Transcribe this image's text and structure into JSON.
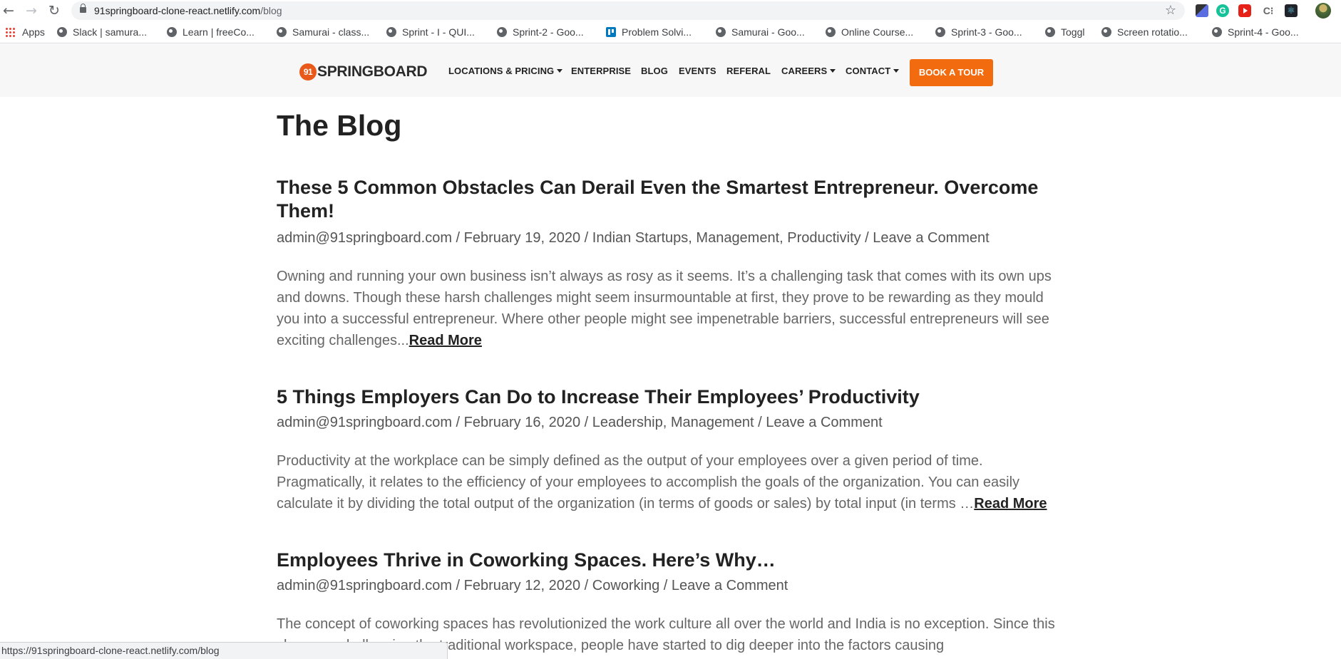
{
  "browser": {
    "url_host": "91springboard-clone-react.netlify.com",
    "url_path": "/blog",
    "bookmarks": [
      {
        "label": "Apps",
        "icon": "apps-grid-icon"
      },
      {
        "label": "Slack | samura...",
        "icon": "globe-icon"
      },
      {
        "label": "Learn | freeCo...",
        "icon": "globe-icon"
      },
      {
        "label": "Samurai - class...",
        "icon": "globe-icon"
      },
      {
        "label": "Sprint - I - QUI...",
        "icon": "globe-icon"
      },
      {
        "label": "Sprint-2 - Goo...",
        "icon": "globe-icon"
      },
      {
        "label": "Problem Solvi...",
        "icon": "trello-icon"
      },
      {
        "label": "Samurai - Goo...",
        "icon": "globe-icon"
      },
      {
        "label": "Online Course...",
        "icon": "globe-icon"
      },
      {
        "label": "Sprint-3 - Goo...",
        "icon": "globe-icon"
      },
      {
        "label": "Toggl",
        "icon": "globe-icon"
      },
      {
        "label": "Screen rotatio...",
        "icon": "globe-icon"
      },
      {
        "label": "Sprint-4 - Goo...",
        "icon": "globe-icon"
      }
    ],
    "status_url": "https://91springboard-clone-react.netlify.com/blog"
  },
  "site": {
    "logo_number": "91",
    "logo_text": "SPRINGBOARD",
    "brand_color": "#f26b0f",
    "nav": [
      {
        "label": "LOCATIONS & PRICING",
        "dropdown": true
      },
      {
        "label": "ENTERPRISE",
        "dropdown": false
      },
      {
        "label": "BLOG",
        "dropdown": false
      },
      {
        "label": "EVENTS",
        "dropdown": false
      },
      {
        "label": "REFERAL",
        "dropdown": false
      },
      {
        "label": "CAREERS",
        "dropdown": true
      },
      {
        "label": "CONTACT",
        "dropdown": true
      }
    ],
    "cta_label": "BOOK A TOUR"
  },
  "page": {
    "title": "The Blog",
    "posts": [
      {
        "title": "These 5 Common Obstacles Can Derail Even the Smartest Entrepreneur. Overcome Them!",
        "meta": "admin@91springboard.com / February 19, 2020 / Indian Startups, Management, Productivity / Leave a Comment",
        "excerpt": "Owning and running your own business isn’t always as rosy as it seems. It’s a challenging task that comes with its own ups and downs. Though these harsh challenges might seem insurmountable at first, they prove to be rewarding as they mould you into a successful entrepreneur. Where other people might see impenetrable barriers, successful entrepreneurs will see exciting challenges...",
        "read_more": "Read More"
      },
      {
        "title": "5 Things Employers Can Do to Increase Their Employees’ Productivity",
        "meta": "admin@91springboard.com / February 16, 2020 / Leadership, Management / Leave a Comment",
        "excerpt": "Productivity at the workplace can be simply defined as the output of your employees over a given period of time. Pragmatically, it relates to the efficiency of your employees to accomplish the goals of the organization. You can easily calculate it by dividing the total output of the organization (in terms of goods or sales) by total input (in terms …",
        "read_more": "Read More"
      },
      {
        "title": "Employees Thrive in Coworking Spaces. Here’s Why…",
        "meta": "admin@91springboard.com / February 12, 2020 / Coworking / Leave a Comment",
        "excerpt": "The concept of coworking spaces has revolutionized the work culture all over the world and India is no exception. Since this change... challenging the traditional workspace, people have started to dig deeper into the factors causing",
        "read_more": ""
      }
    ]
  }
}
